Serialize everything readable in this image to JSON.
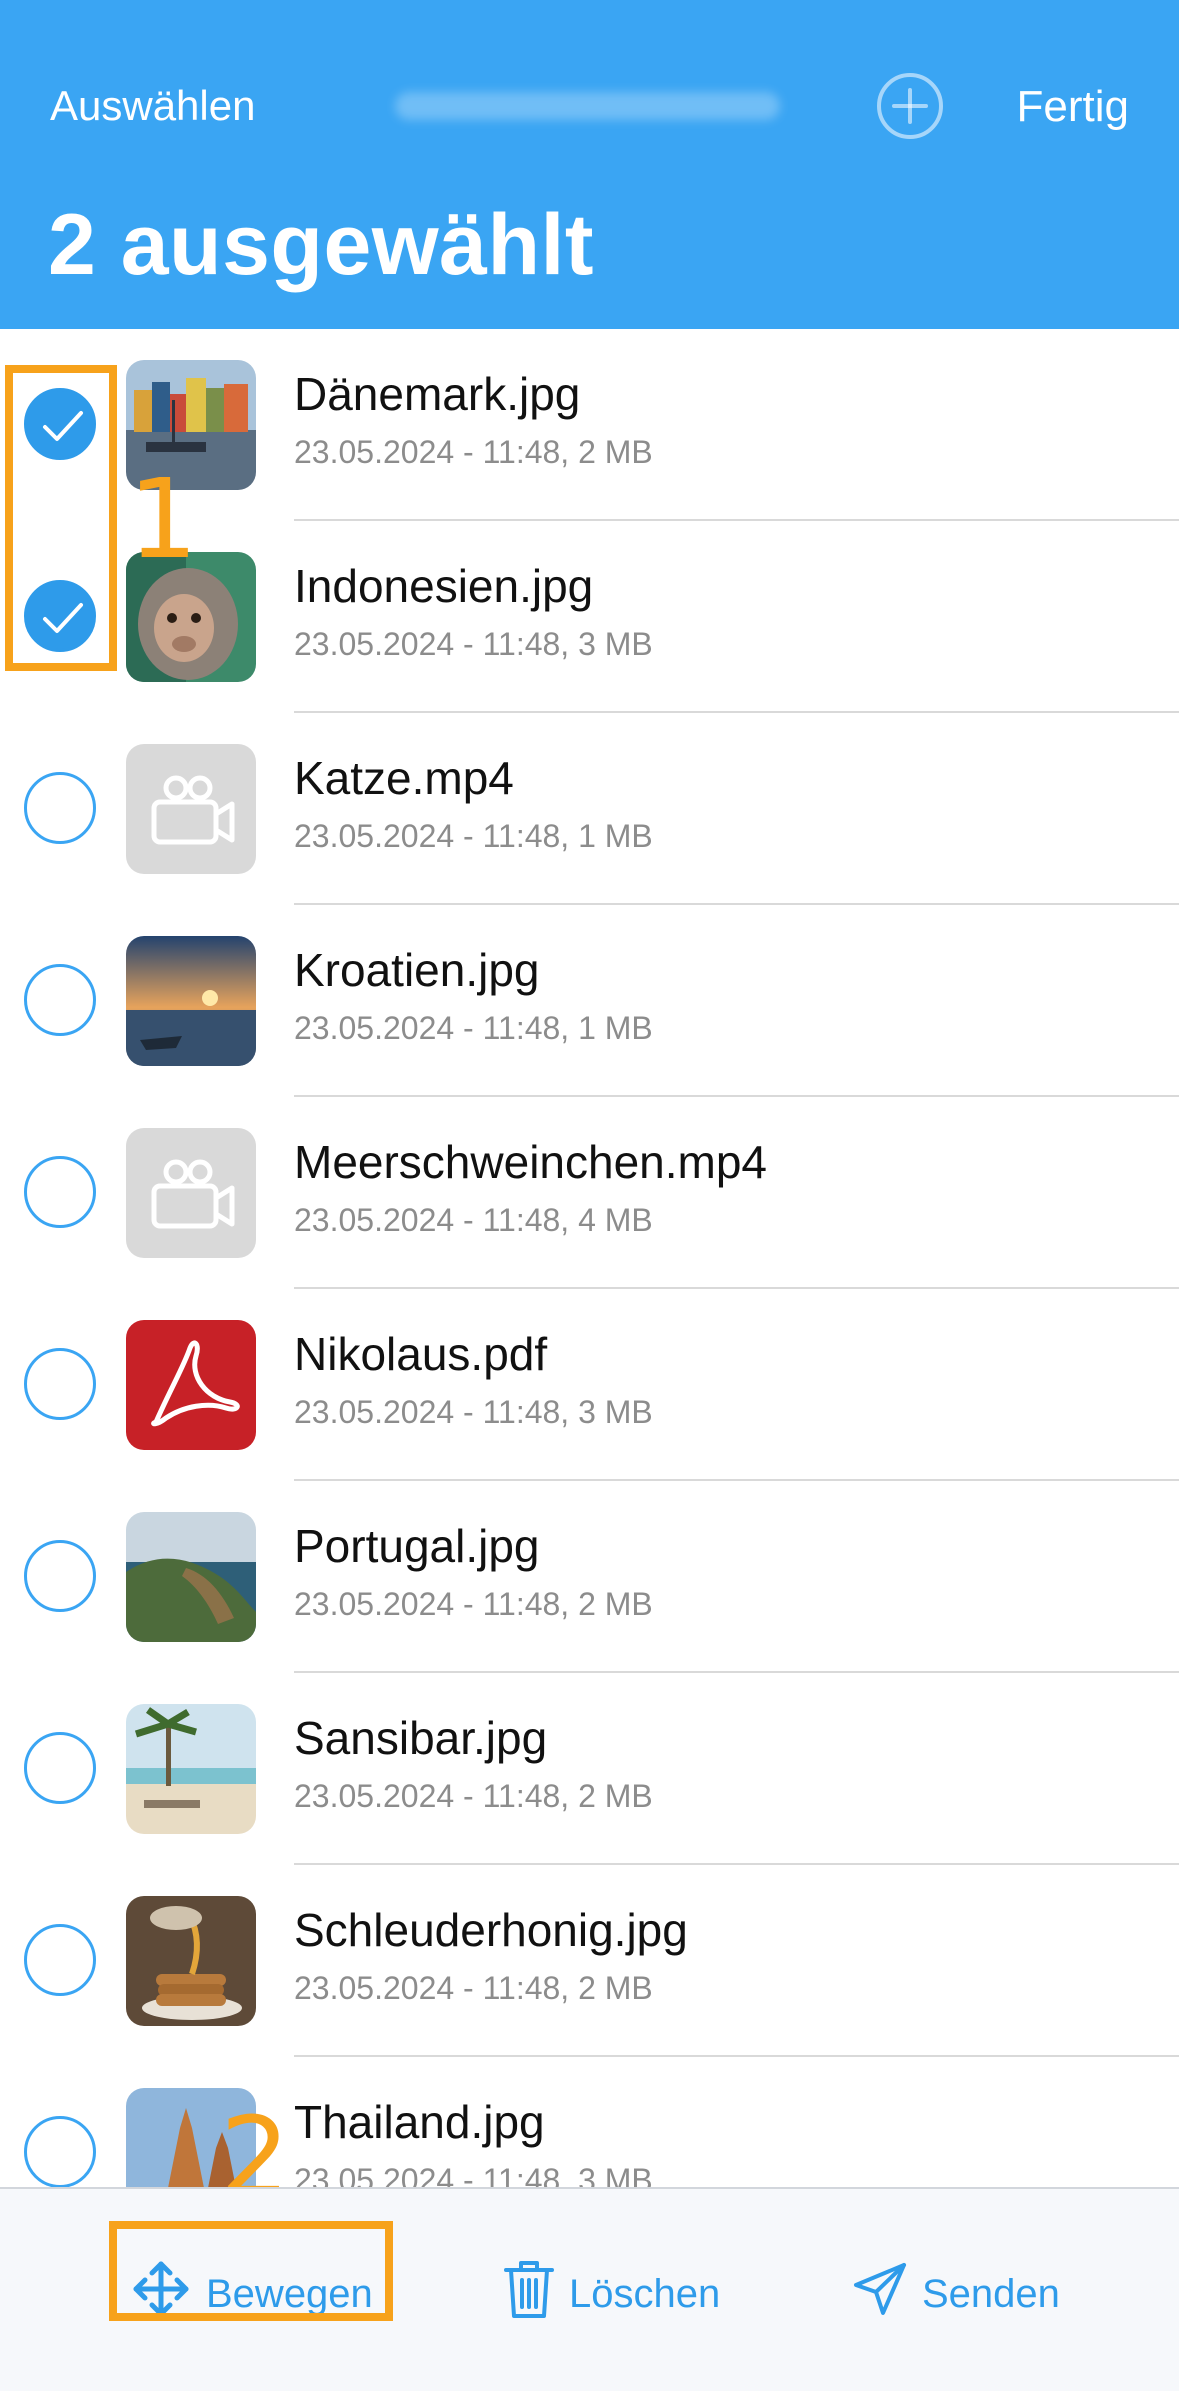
{
  "header": {
    "left_label": "Auswählen",
    "right_label": "Fertig",
    "center_blurred": "",
    "title": "2 ausgewählt"
  },
  "files": [
    {
      "name": "Dänemark.jpg",
      "meta": "23.05.2024 - 11:48, 2 MB",
      "selected": true,
      "thumb": "harbor-photo"
    },
    {
      "name": "Indonesien.jpg",
      "meta": "23.05.2024 - 11:48, 3 MB",
      "selected": true,
      "thumb": "monkey-photo"
    },
    {
      "name": "Katze.mp4",
      "meta": "23.05.2024 - 11:48, 1 MB",
      "selected": false,
      "thumb": "video-icon"
    },
    {
      "name": "Kroatien.jpg",
      "meta": "23.05.2024 - 11:48, 1 MB",
      "selected": false,
      "thumb": "sunset-boat-photo"
    },
    {
      "name": "Meerschweinchen.mp4",
      "meta": "23.05.2024 - 11:48, 4 MB",
      "selected": false,
      "thumb": "video-icon"
    },
    {
      "name": "Nikolaus.pdf",
      "meta": "23.05.2024 - 11:48, 3 MB",
      "selected": false,
      "thumb": "pdf-icon"
    },
    {
      "name": "Portugal.jpg",
      "meta": "23.05.2024 - 11:48, 2 MB",
      "selected": false,
      "thumb": "coast-photo"
    },
    {
      "name": "Sansibar.jpg",
      "meta": "23.05.2024 - 11:48, 2 MB",
      "selected": false,
      "thumb": "beach-photo"
    },
    {
      "name": "Schleuderhonig.jpg",
      "meta": "23.05.2024 - 11:48, 2 MB",
      "selected": false,
      "thumb": "pancake-photo"
    },
    {
      "name": "Thailand.jpg",
      "meta": "23.05.2024 - 11:48, 3 MB",
      "selected": false,
      "thumb": "temple-photo"
    }
  ],
  "toolbar": {
    "move_label": "Bewegen",
    "delete_label": "Löschen",
    "send_label": "Senden"
  },
  "annotations": {
    "one": "1",
    "two": "2"
  },
  "colors": {
    "accent": "#3aa5f3",
    "highlight": "#f7a21b"
  }
}
